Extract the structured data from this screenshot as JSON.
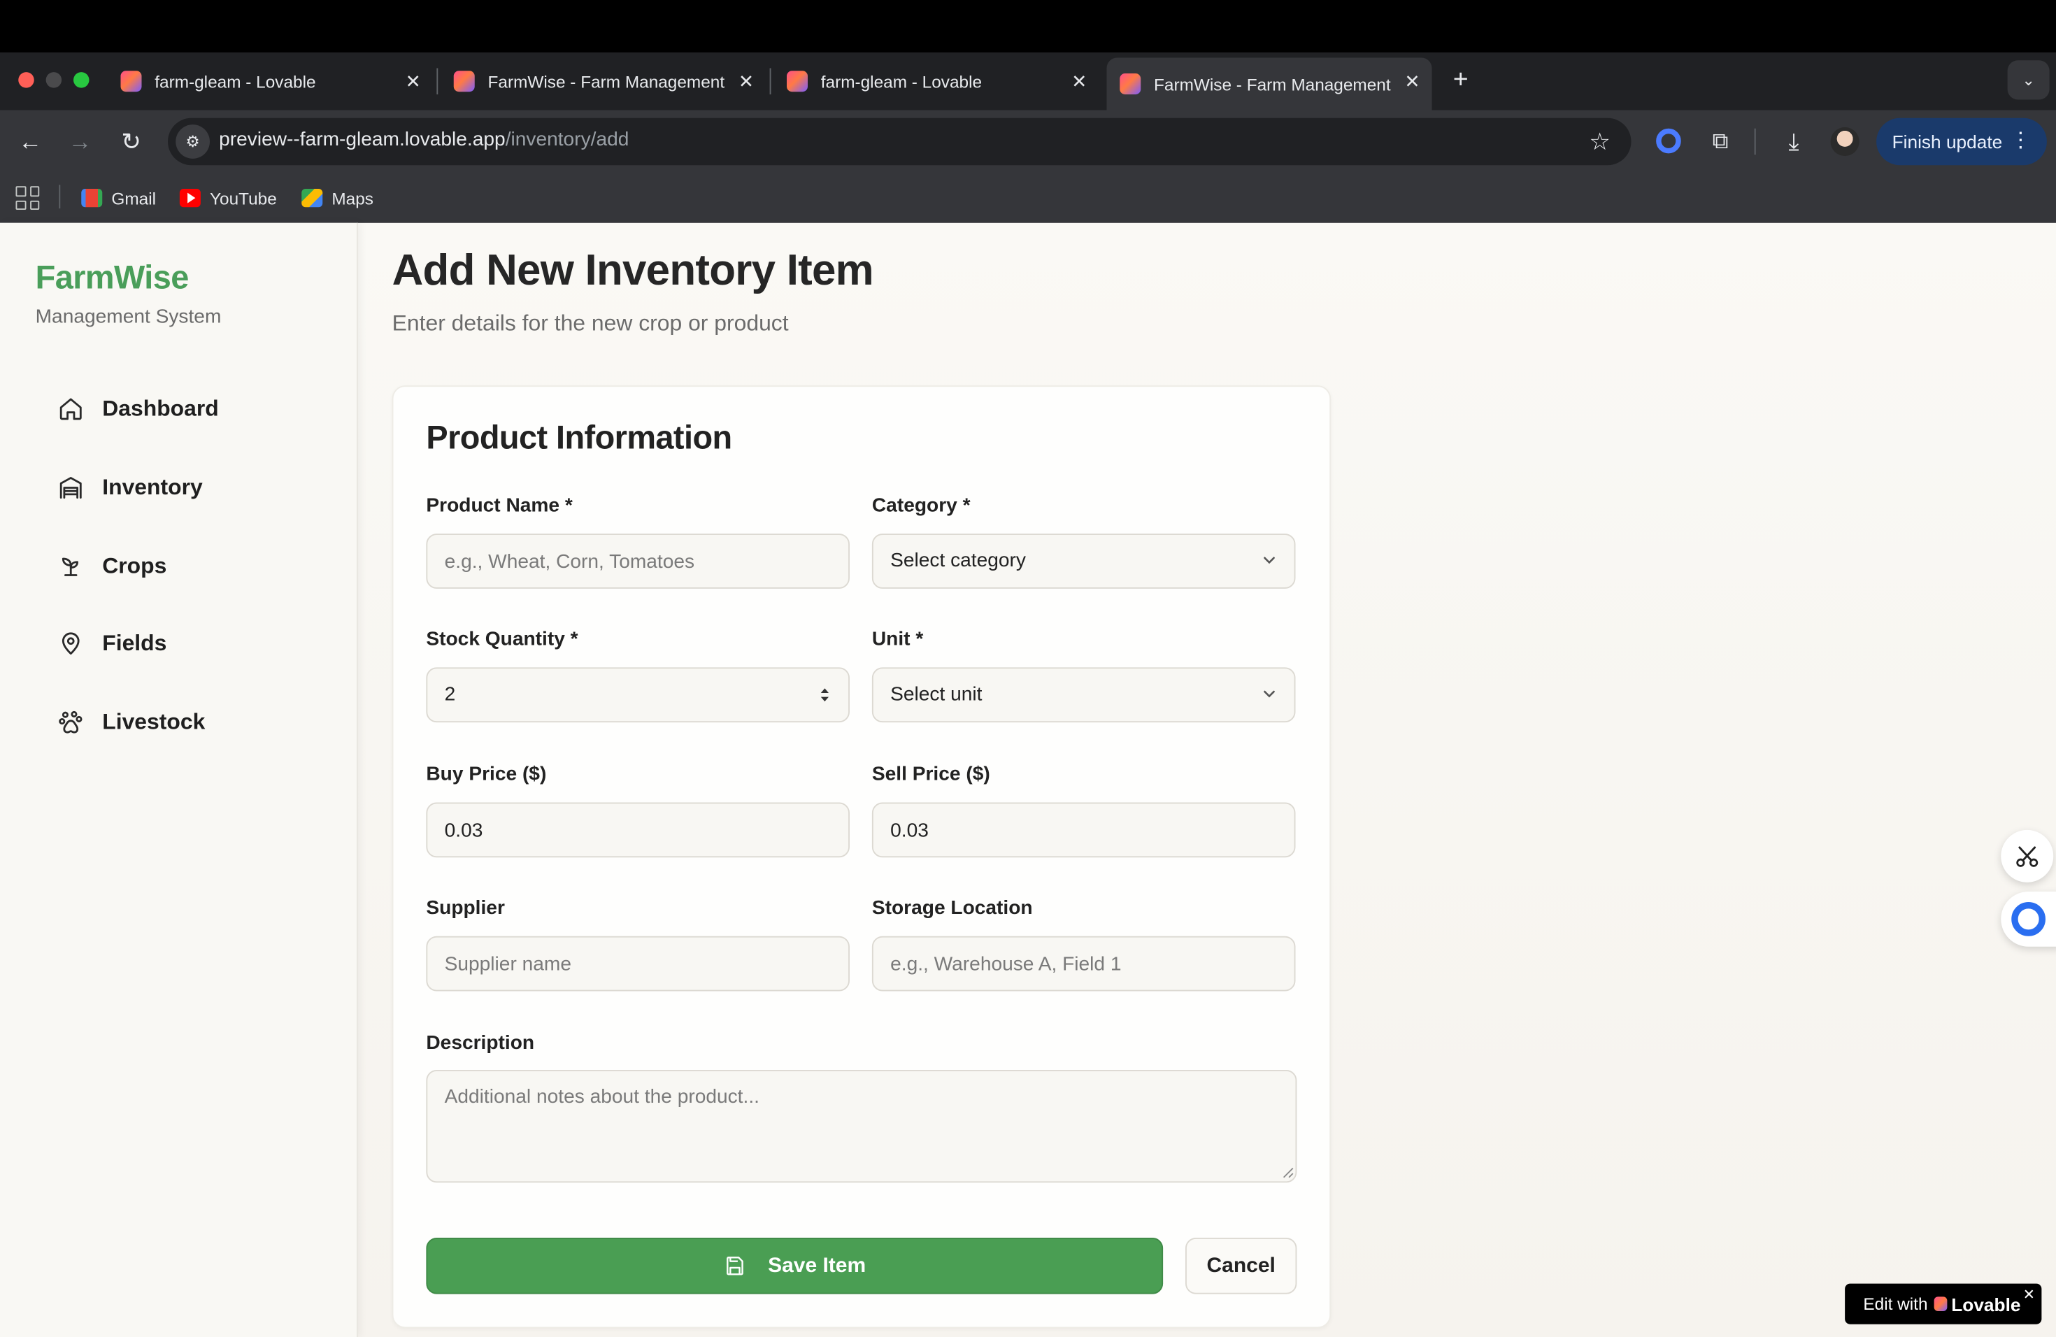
{
  "browser": {
    "tabs": [
      {
        "title": "farm-gleam - Lovable",
        "active": false
      },
      {
        "title": "FarmWise - Farm Management",
        "active": false
      },
      {
        "title": "farm-gleam - Lovable",
        "active": false
      },
      {
        "title": "FarmWise - Farm Management",
        "active": true
      }
    ],
    "url_host": "preview--farm-gleam.lovable.app",
    "url_path": "/inventory/add",
    "finish_update_label": "Finish update",
    "bookmarks": [
      "Gmail",
      "YouTube",
      "Maps"
    ]
  },
  "sidebar": {
    "brand": "FarmWise",
    "subtitle": "Management System",
    "items": [
      {
        "label": "Dashboard",
        "icon": "home-icon"
      },
      {
        "label": "Inventory",
        "icon": "warehouse-icon"
      },
      {
        "label": "Crops",
        "icon": "sprout-icon"
      },
      {
        "label": "Fields",
        "icon": "map-pin-icon"
      },
      {
        "label": "Livestock",
        "icon": "paw-icon"
      }
    ]
  },
  "page": {
    "title": "Add New Inventory Item",
    "subtitle": "Enter details for the new crop or product"
  },
  "form": {
    "section_title": "Product Information",
    "product_name": {
      "label": "Product Name *",
      "placeholder": "e.g., Wheat, Corn, Tomatoes",
      "value": ""
    },
    "category": {
      "label": "Category *",
      "value": "Select category"
    },
    "stock_quantity": {
      "label": "Stock Quantity *",
      "value": "2"
    },
    "unit": {
      "label": "Unit *",
      "value": "Select unit"
    },
    "buy_price": {
      "label": "Buy Price ($)",
      "value": "0.03"
    },
    "sell_price": {
      "label": "Sell Price ($)",
      "value": "0.03"
    },
    "supplier": {
      "label": "Supplier",
      "placeholder": "Supplier name",
      "value": ""
    },
    "storage_location": {
      "label": "Storage Location",
      "placeholder": "e.g., Warehouse A, Field 1",
      "value": ""
    },
    "description": {
      "label": "Description",
      "placeholder": "Additional notes about the product...",
      "value": ""
    },
    "save_label": "Save Item",
    "cancel_label": "Cancel"
  },
  "overlay": {
    "edit_with": "Edit with",
    "lovable": "Lovable"
  },
  "colors": {
    "brand_green": "#4a9e5a",
    "save_button": "#4a9e53",
    "chat_accent": "#2a6ef0"
  }
}
